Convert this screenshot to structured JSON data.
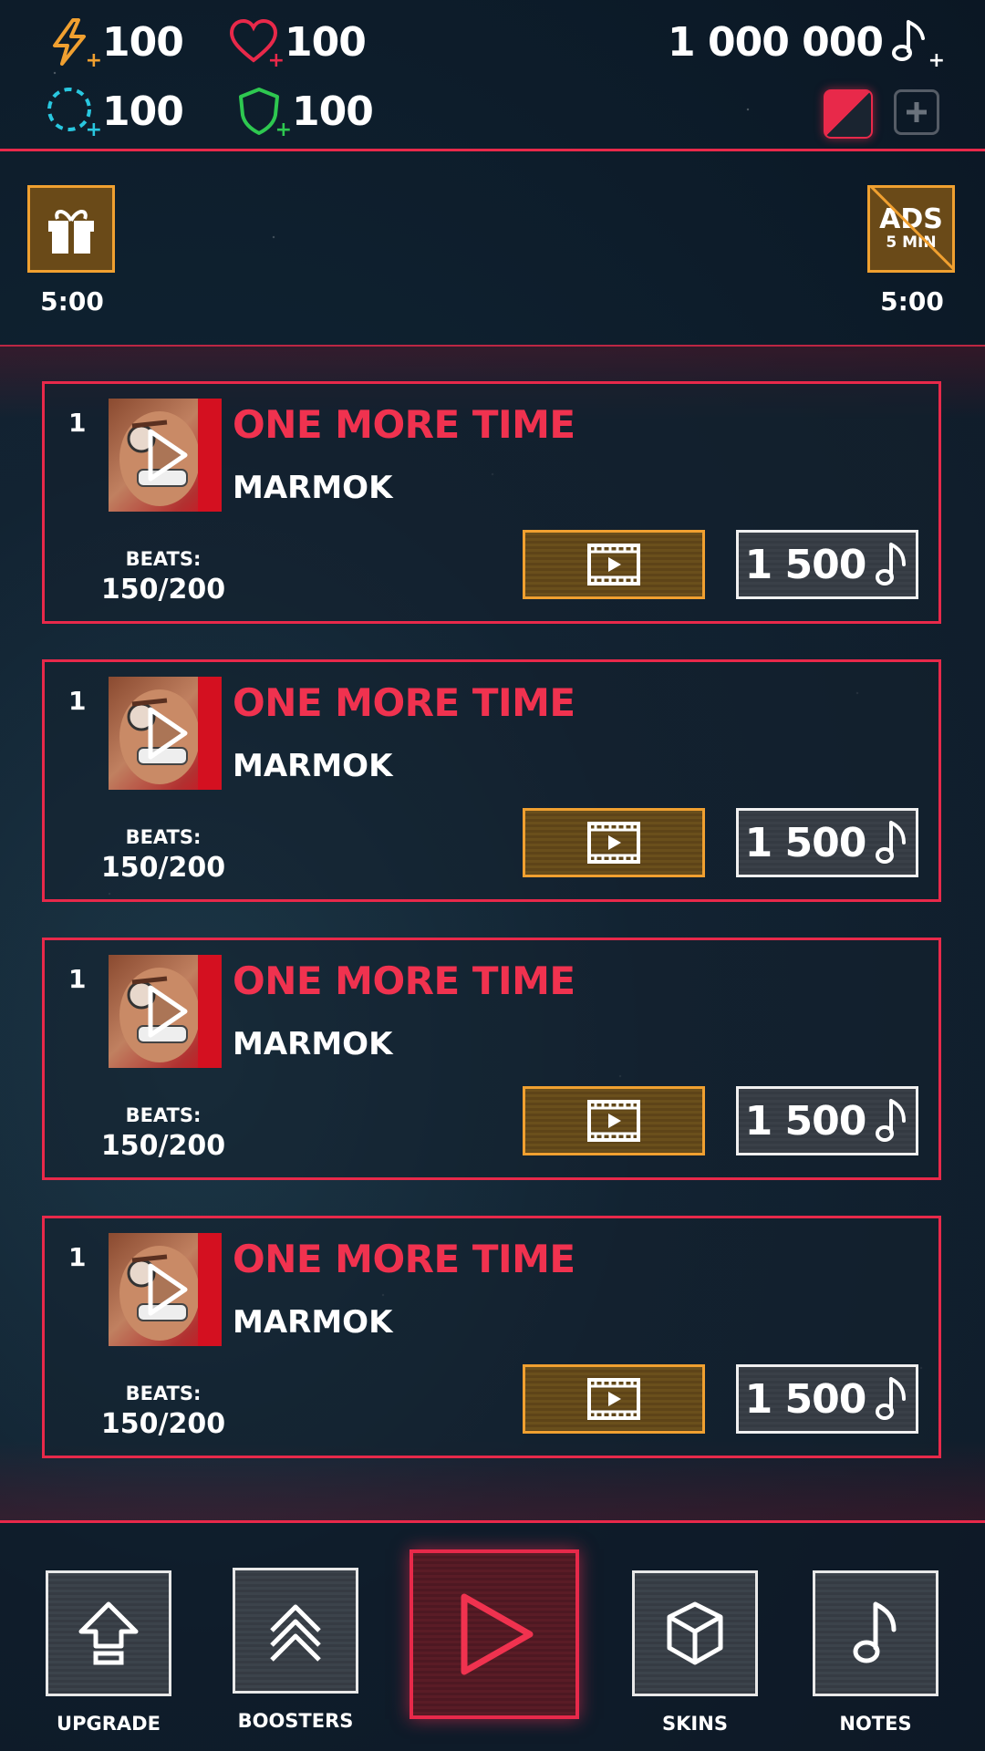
{
  "stats": {
    "energy": "100",
    "health": "100",
    "shield_ring": "100",
    "armor": "100",
    "notes_balance": "1 000 000"
  },
  "rewards": {
    "gift_timer": "5:00",
    "ads_line1": "ADS",
    "ads_line2": "5 MIN",
    "ads_timer": "5:00"
  },
  "tracks": [
    {
      "rank": "1",
      "title": "ONE MORE TIME",
      "artist": "MARMOK",
      "beats_label": "BEATS:",
      "beats": "150/200",
      "price": "1 500"
    },
    {
      "rank": "1",
      "title": "ONE MORE TIME",
      "artist": "MARMOK",
      "beats_label": "BEATS:",
      "beats": "150/200",
      "price": "1 500"
    },
    {
      "rank": "1",
      "title": "ONE MORE TIME",
      "artist": "MARMOK",
      "beats_label": "BEATS:",
      "beats": "150/200",
      "price": "1 500"
    },
    {
      "rank": "1",
      "title": "ONE MORE TIME",
      "artist": "MARMOK",
      "beats_label": "BEATS:",
      "beats": "150/200",
      "price": "1 500"
    }
  ],
  "nav": {
    "upgrade": "UPGRADE",
    "boosters": "BOOSTERS",
    "skins": "SKINS",
    "notes": "NOTES"
  },
  "colors": {
    "accent_red": "#e8294a",
    "gold": "#f0a030",
    "energy_icon": "#f0a030",
    "health_icon": "#e8294a",
    "ring_icon": "#29c8e0",
    "armor_icon": "#2ec850"
  },
  "icons": [
    "lightning-icon",
    "heart-icon",
    "ring-icon",
    "shield-icon",
    "music-note-icon",
    "gift-icon",
    "video-icon",
    "upgrade-arrow-icon",
    "boosters-chevrons-icon",
    "play-icon",
    "cube-icon"
  ]
}
